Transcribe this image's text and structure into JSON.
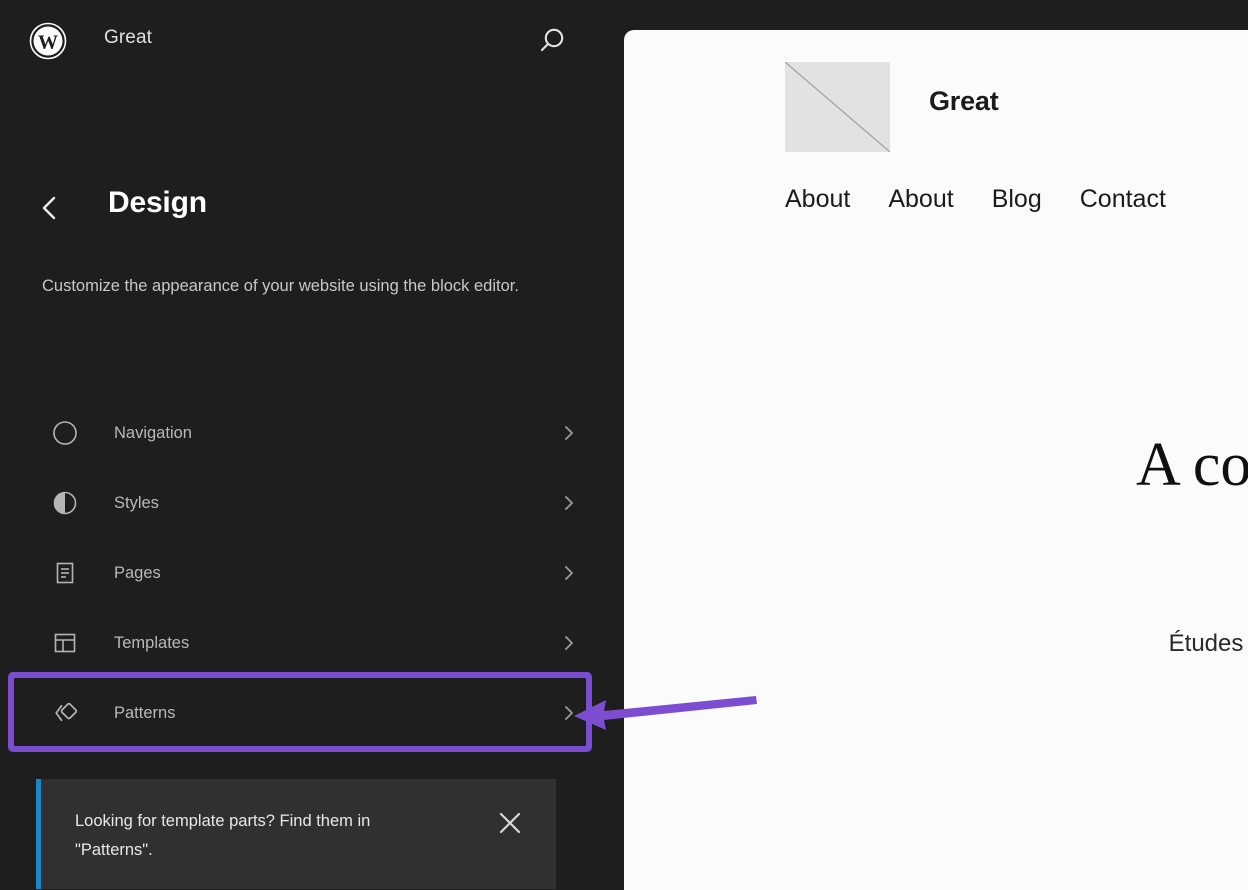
{
  "sidebar": {
    "logo_icon": "wordpress-logo-icon",
    "site_title": "Great",
    "search_icon": "search-icon",
    "back_icon": "chevron-left-icon",
    "page_title": "Design",
    "description": "Customize the appearance of your website using the block editor.",
    "menu": [
      {
        "label": "Navigation",
        "icon": "compass-icon",
        "chevron": "chevron-right-icon",
        "highlighted": false
      },
      {
        "label": "Styles",
        "icon": "half-circle-icon",
        "chevron": "chevron-right-icon",
        "highlighted": false
      },
      {
        "label": "Pages",
        "icon": "document-icon",
        "chevron": "chevron-right-icon",
        "highlighted": false
      },
      {
        "label": "Templates",
        "icon": "layout-icon",
        "chevron": "chevron-right-icon",
        "highlighted": false
      },
      {
        "label": "Patterns",
        "icon": "patterns-icon",
        "chevron": "chevron-right-icon",
        "highlighted": true
      }
    ],
    "notice": {
      "text": "Looking for template parts? Find them in \"Patterns\".",
      "close_icon": "close-icon",
      "accent_color": "#1a87c9"
    }
  },
  "annotation": {
    "type": "arrow",
    "points_to": "Patterns",
    "color": "#7c4dd1"
  },
  "preview": {
    "logo_icon": "image-placeholder-icon",
    "site_title": "Great",
    "nav_links": [
      "About",
      "About",
      "Blog",
      "Contact"
    ],
    "heading": "A co",
    "subtext": "Études"
  },
  "colors": {
    "sidebar_bg": "#1e1e1e",
    "preview_bg": "#fbfbfb",
    "accent_purple": "#7c4dd1",
    "notice_bg": "#303030",
    "notice_accent": "#1a87c9"
  }
}
